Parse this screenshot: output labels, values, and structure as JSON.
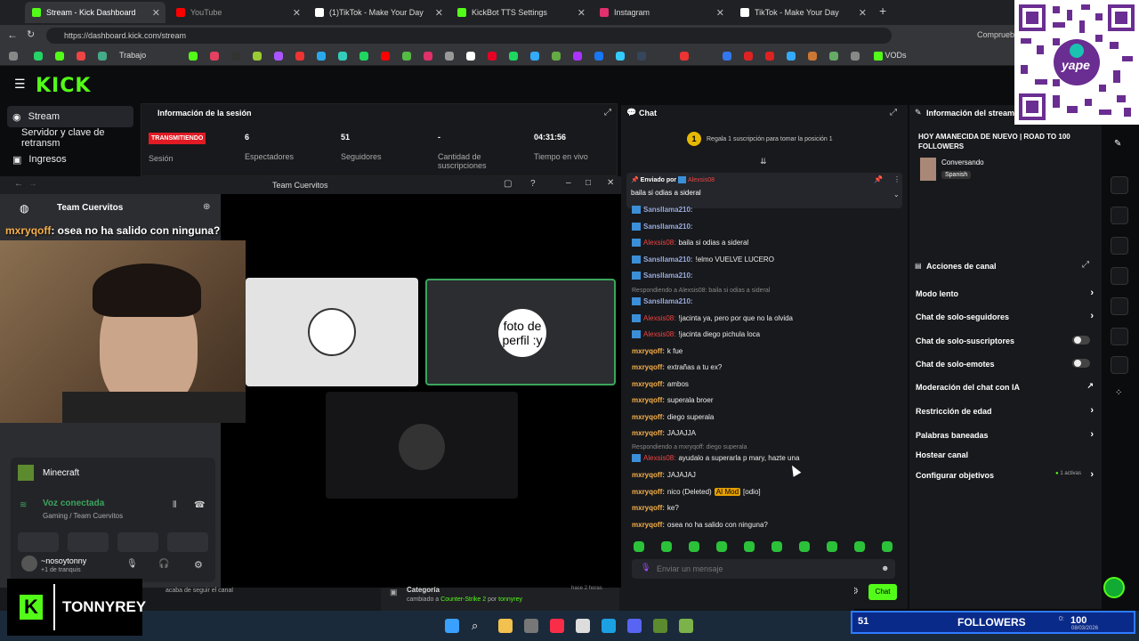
{
  "browser": {
    "tabs": [
      {
        "title": "Stream - Kick Dashboard",
        "color": "#53fc18"
      },
      {
        "title": "YouTube",
        "color": "#ff0000"
      },
      {
        "title": "(1)TikTok - Make Your Day",
        "color": "#ffffff"
      },
      {
        "title": "KickBot TTS Settings",
        "color": "#53fc18"
      },
      {
        "title": "Instagram",
        "color": "#e1306c"
      },
      {
        "title": "TikTok - Make Your Day",
        "color": "#ffffff"
      }
    ],
    "url": "https://dashboard.kick.com/stream",
    "bookmark_folder": "Trabajo",
    "bookmark_vods": "VODs",
    "profile_label": "Compruebe"
  },
  "kick": {
    "logo": "KICK",
    "sidebar": [
      {
        "label": "Stream",
        "icon": "broadcast-icon"
      },
      {
        "label": "Servidor y clave de retransm",
        "icon": ""
      },
      {
        "label": "Ingresos",
        "icon": "wallet-icon"
      }
    ],
    "session": {
      "title": "Información de la sesión",
      "status": "TRANSMITIENDO",
      "status_label": "Sesión",
      "stats": [
        {
          "value": "6",
          "label": "Espectadores"
        },
        {
          "value": "51",
          "label": "Seguidores"
        },
        {
          "value": "-",
          "label": "Cantidad de suscripciones"
        },
        {
          "value": "04:31:56",
          "label": "Tiempo en vivo"
        }
      ]
    },
    "chat": {
      "title": "Chat",
      "gift_text": "Regala 1 suscripción para tomar la posición 1",
      "pinned_by_label": "Enviado por",
      "pinned_user": "Alexsis08",
      "pinned_text": "baila si odias a sideral",
      "messages": [
        {
          "user": "Sansllama210:",
          "text": "",
          "style": "blue"
        },
        {
          "user": "Sansllama210:",
          "text": "",
          "style": "blue"
        },
        {
          "user": "Alexsis08:",
          "text": "baila si odias a sideral",
          "style": "red"
        },
        {
          "user": "Sansllama210:",
          "text": "!elmo VUELVE LUCERO",
          "style": "blue"
        },
        {
          "user": "Sansllama210:",
          "text": "",
          "style": "blue"
        },
        {
          "user": "Sansllama210:",
          "text": "",
          "style": "blue"
        },
        {
          "user": "Alexsis08:",
          "text": "!jacinta ya, pero por que no la olvida",
          "style": "red"
        },
        {
          "user": "Alexsis08:",
          "text": "!jacinta diego pichula loca",
          "style": "red"
        },
        {
          "user": "mxryqoff:",
          "text": "k fue",
          "style": "orange"
        },
        {
          "user": "mxryqoff:",
          "text": "extrañas a tu ex?",
          "style": "orange"
        },
        {
          "user": "mxryqoff:",
          "text": "ambos",
          "style": "orange"
        },
        {
          "user": "mxryqoff:",
          "text": "superala broer",
          "style": "orange"
        },
        {
          "user": "mxryqoff:",
          "text": "diego superala",
          "style": "orange"
        },
        {
          "user": "mxryqoff:",
          "text": "JAJAJJA",
          "style": "orange"
        },
        {
          "user": "Alexsis08:",
          "text": "ayudalo a superarla p mary, hazte una",
          "style": "red"
        },
        {
          "user": "mxryqoff:",
          "text": "JAJAJAJ",
          "style": "orange"
        },
        {
          "user": "mxryqoff:",
          "text": "nico (Deleted)",
          "style": "orange"
        },
        {
          "user": "mxryqoff:",
          "text": "ke?",
          "style": "orange"
        },
        {
          "user": "mxryqoff:",
          "text": "osea no ha salido con ninguna?",
          "style": "orange"
        }
      ],
      "reply1": "Respondiendo a Alexsis08: baila si odias a sideral",
      "reply2": "Respondiendo a mxryqoff: diego superala",
      "ai_mod": "AI Mod",
      "odio_tag": "[odio]",
      "input_placeholder": "Enviar un mensaje",
      "count": "0",
      "send_label": "Chat"
    },
    "stream_info": {
      "title": "Información del stream",
      "stream_title": "HOY AMANECIDA DE NUEVO | ROAD TO 100 FOLLOWERS",
      "category": "Conversando",
      "language": "Spanish"
    },
    "channel_actions": {
      "title": "Acciones de canal",
      "items": [
        {
          "label": "Modo lento",
          "control": "chevron"
        },
        {
          "label": "Chat de solo-seguidores",
          "control": "chevron"
        },
        {
          "label": "Chat de solo-suscriptores",
          "control": "toggle"
        },
        {
          "label": "Chat de solo-emotes",
          "control": "toggle"
        },
        {
          "label": "Moderación del chat con IA",
          "control": "external"
        },
        {
          "label": "Restricción de edad",
          "control": "chevron"
        },
        {
          "label": "Palabras baneadas",
          "control": "chevron"
        },
        {
          "label": "Hostear canal",
          "control": "none"
        },
        {
          "label": "Configurar objetivos",
          "control": "chevron"
        }
      ],
      "goals_active": "1 activas"
    },
    "activity": {
      "followed_text": "acaba de seguir el canal",
      "category_label": "Categoría",
      "category_change": "cambiado a",
      "category_new": "Counter-Strike 2",
      "category_by": "por",
      "category_user": "tonnyrey",
      "category_time": "hace 2 horas"
    }
  },
  "discord": {
    "window_title": "Team Cuervitos",
    "server_name": "Team Cuervitos",
    "overlay_user": "mxryqoff",
    "overlay_text": ": osea no ha salido con ninguna?",
    "tile_text": "foto de perfil :y",
    "game": "Minecraft",
    "voice_status": "Voz conectada",
    "voice_channel": "Gaming / Team Cuervitos",
    "user_name": "~nosoytonny",
    "user_status": "de tranquis",
    "user_extra": "+1"
  },
  "overlay": {
    "brand": "TONNYREY",
    "followers_count": "51",
    "followers_label": "FOLLOWERS",
    "followers_goal": "100",
    "time": "0:",
    "date": "08/03/2026",
    "qr_text": "yape"
  }
}
